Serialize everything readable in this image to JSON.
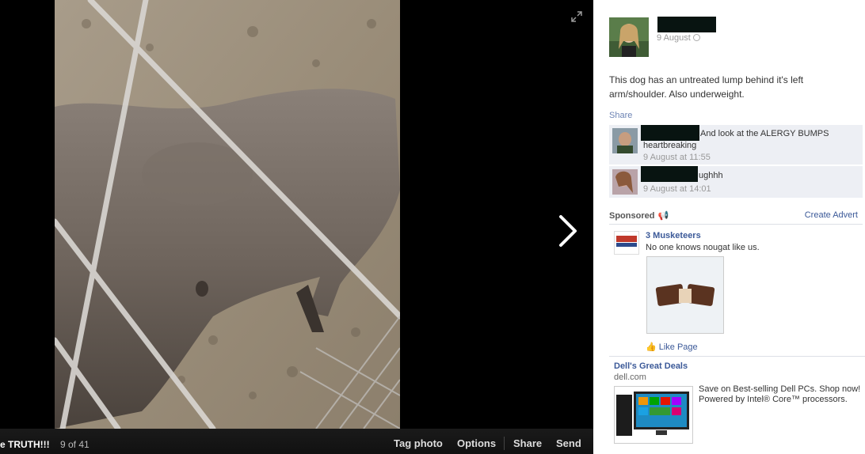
{
  "photo_viewer": {
    "album_title": "e TRUTH!!!",
    "photo_count": "9 of 41",
    "actions": {
      "tag_photo": "Tag photo",
      "options": "Options",
      "share": "Share",
      "send": "Send"
    },
    "expand_icon": "expand-icon",
    "next_icon": "chevron-right-icon"
  },
  "post": {
    "date": "9 August",
    "text": "This dog has an untreated lump behind it's left arm/shoulder. Also underweight.",
    "share_label": "Share"
  },
  "comments": [
    {
      "text": "And look at the ALERGY BUMPS",
      "text2": "heartbreaking",
      "date": "9 August at 11:55"
    },
    {
      "text": "ughhh",
      "date": "9 August at 14:01"
    }
  ],
  "sponsored": {
    "label": "Sponsored",
    "create_advert": "Create Advert"
  },
  "ads": [
    {
      "title": "3 Musketeers",
      "text": "No one knows nougat like us.",
      "like_label": "Like Page"
    },
    {
      "title": "Dell's Great Deals",
      "domain": "dell.com",
      "text": "Save on Best-selling Dell PCs. Shop now! Powered by Intel® Core™ processors."
    }
  ],
  "colors": {
    "link": "#3b5998",
    "comment_bg": "#edeff4",
    "viewer_bg": "#000000"
  }
}
